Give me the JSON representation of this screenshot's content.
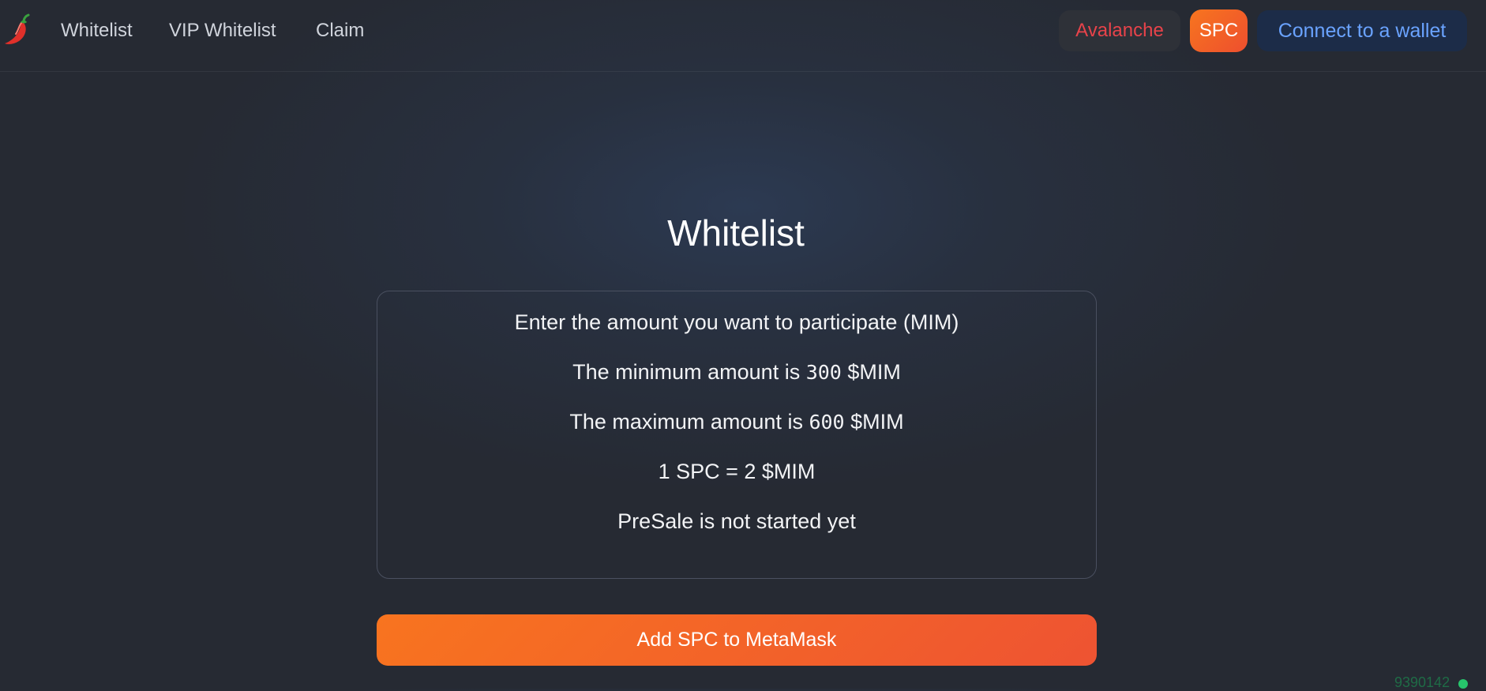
{
  "nav": {
    "logo_icon": "chili-pepper-icon",
    "links": [
      "Whitelist",
      "VIP Whitelist",
      "Claim"
    ]
  },
  "header_actions": {
    "chain_label": "Avalanche",
    "token_label": "SPC",
    "wallet_label": "Connect to a wallet"
  },
  "main": {
    "title": "Whitelist",
    "instruction": "Enter the amount you want to participate (MIM)",
    "min_prefix": "The minimum amount is ",
    "min_value": "300",
    "min_suffix": " $MIM",
    "max_prefix": "The maximum amount is ",
    "max_value": "600",
    "max_suffix": " $MIM",
    "rate": "1 SPC = 2 $MIM",
    "status": "PreSale is not started yet",
    "metamask_button": "Add SPC to MetaMask"
  },
  "footer": {
    "block_number": "9390142"
  },
  "colors": {
    "accent_orange": "#f7751f",
    "chain_red": "#e8434a",
    "wallet_blue": "#6aa3ff",
    "status_green": "#27c56c"
  }
}
